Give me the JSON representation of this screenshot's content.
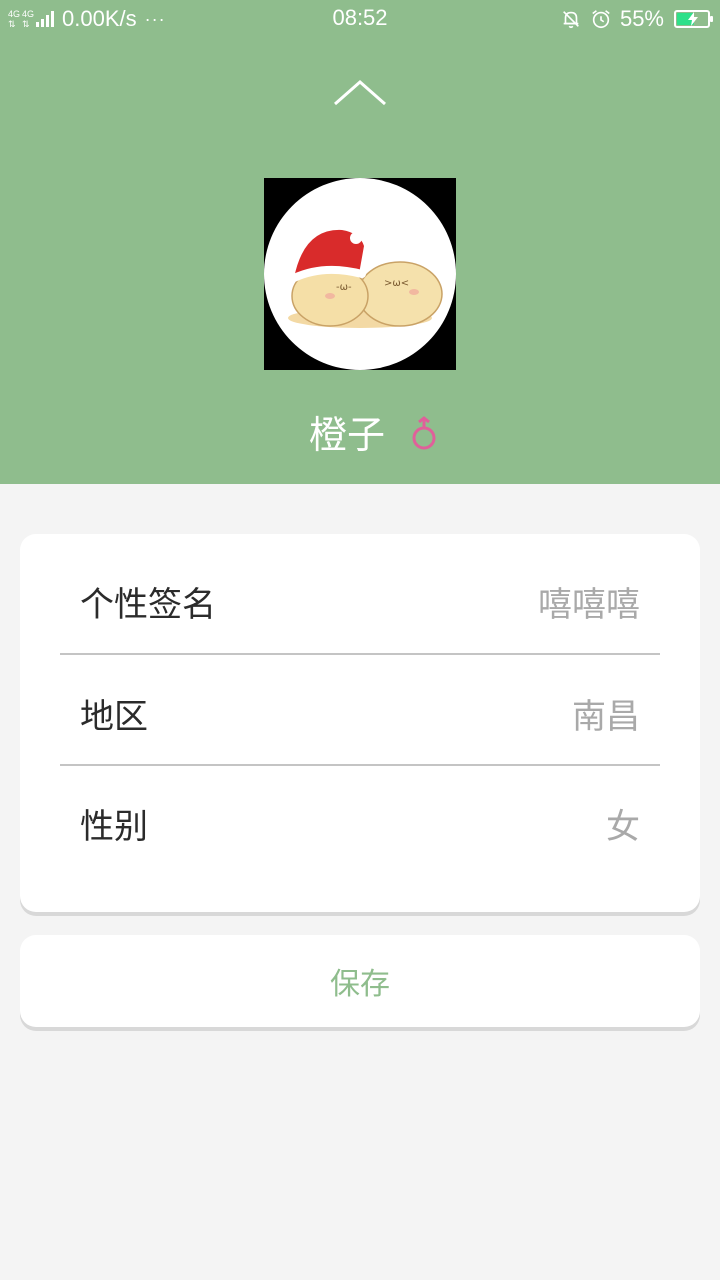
{
  "status_bar": {
    "network_label": "4G",
    "speed": "0.00K/s",
    "more": "···",
    "time": "08:52",
    "battery_percent": "55%",
    "battery_level": 0.55,
    "icons": [
      "signal-icon",
      "mute-bell-icon",
      "alarm-icon",
      "battery-icon"
    ]
  },
  "profile": {
    "name": "橙子",
    "gender_icon": "female-icon",
    "avatar_icon": "avatar-image"
  },
  "info": {
    "rows": [
      {
        "label": "个性签名",
        "value": "嘻嘻嘻"
      },
      {
        "label": "地区",
        "value": "南昌"
      },
      {
        "label": "性别",
        "value": "女"
      }
    ]
  },
  "actions": {
    "save_label": "保存",
    "collapse_icon": "chevron-up-icon"
  },
  "colors": {
    "header_bg": "#8fbd8d",
    "accent": "#8fbd8d",
    "female_icon": "#e0609a"
  }
}
